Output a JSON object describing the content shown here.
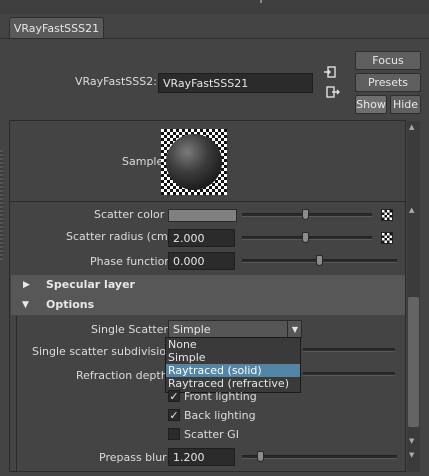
{
  "tab": {
    "label": "VRayFastSSS21"
  },
  "node": {
    "label": "VRayFastSSS2:",
    "value": "VRayFastSSS21"
  },
  "buttons": {
    "focus": "Focus",
    "presets": "Presets",
    "show": "Show",
    "hide": "Hide"
  },
  "sample": {
    "label": "Sample"
  },
  "attributes": {
    "scatter_color": {
      "label": "Scatter color",
      "slider": 0.49
    },
    "scatter_radius": {
      "label": "Scatter radius (cm)",
      "value": "2.000",
      "slider": 0.49
    },
    "phase_function": {
      "label": "Phase function",
      "value": "0.000",
      "slider": 0.5
    }
  },
  "sections": {
    "specular": "Specular layer",
    "options": "Options"
  },
  "options": {
    "single_scatter_label": "Single Scatter",
    "single_scatter_value": "Simple",
    "single_scatter_options": [
      "None",
      "Simple",
      "Raytraced (solid)",
      "Raytraced (refractive)"
    ],
    "highlighted_option": "Raytraced (solid)",
    "subdivisions_label": "Single scatter subdivisions",
    "refraction_depth_label": "Refraction depth",
    "front_lighting": "Front lighting",
    "back_lighting": "Back lighting",
    "scatter_gi": "Scatter GI",
    "prepass_blur_label": "Prepass blur",
    "prepass_blur_value": "1.200",
    "prepass_blur_slider": 0.1
  },
  "colors": {
    "highlight": "#5285a6",
    "background": "#444444",
    "scatter_color_swatch": "#808080"
  }
}
